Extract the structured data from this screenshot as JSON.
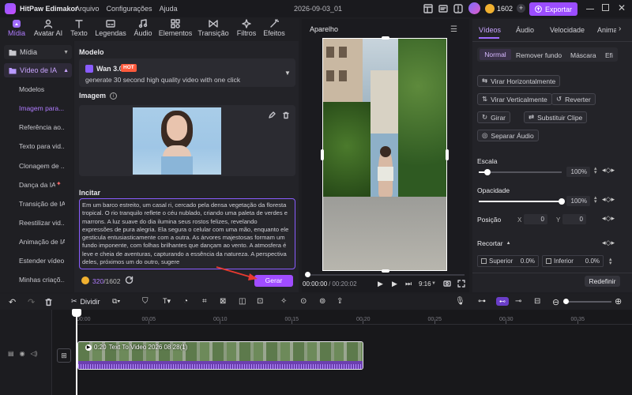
{
  "app": {
    "name": "HitPaw Edimakor",
    "menu": [
      "Arquivo",
      "Configurações",
      "Ajuda"
    ],
    "project": "2026-09-03_01",
    "credits": "1602",
    "export_label": "Exportar"
  },
  "toolbar": {
    "tabs": [
      "Mídia",
      "Avatar AI",
      "Texto",
      "Legendas",
      "Áudio",
      "Elementos",
      "Transição",
      "Filtros",
      "Efeitos"
    ]
  },
  "leftnav": {
    "sections": [
      "Mídia",
      "Vídeo de IA"
    ],
    "items": [
      "Modelos",
      "Imagem para...",
      "Referência ao...",
      "Texto para vid...",
      "Clonagem de ...",
      "Dança da IA",
      "Transição de IA",
      "Reestilizar vid...",
      "Animação de IA",
      "Estender vídeo",
      "Minhas criaçõ..."
    ]
  },
  "gen": {
    "model_label": "Modelo",
    "model_name": "Wan 3.0",
    "model_badge": "HOT",
    "model_desc": "generate 30 second high quality video with one click",
    "image_label": "Imagem",
    "prompt_label": "Incitar",
    "prompt_text": "Em um barco estreito, um casal ri, cercado pela densa vegetação da floresta tropical. O rio tranquilo reflete o céu nublado, criando uma paleta de verdes e marrons. A luz suave do dia ilumina seus rostos felizes, revelando expressões de pura alegria. Ela segura o celular com uma mão, enquanto ele gesticula entusiasticamente com a outra. As árvores majestosas formam um fundo imponente, com folhas brilhantes que dançam ao vento. A atmosfera é leve e cheia de aventuras, capturando a essência da natureza. A perspectiva deles, próximos um do outro, sugere",
    "char_count": "320",
    "char_max": "/1602",
    "generate_label": "Gerar"
  },
  "preview": {
    "title": "Aparelho",
    "time_current": "00:00:00",
    "time_total": "00:20:02",
    "ratio": "9:16",
    "progress": 0.0
  },
  "right": {
    "tabs": [
      "Vídeos",
      "Áudio",
      "Velocidade",
      "Animaç"
    ],
    "subtabs": [
      "Normal",
      "Remover fundo",
      "Máscara",
      "Efi"
    ],
    "buttons": [
      "Virar Horizontalmente",
      "Virar Verticalmente",
      "Reverter",
      "Girar",
      "Substituir Clipe",
      "Separar Áudio"
    ],
    "scale_label": "Escala",
    "scale_value": "100%",
    "scale_level": 0.1,
    "opacity_label": "Opacidade",
    "opacity_value": "100%",
    "opacity_level": 1.0,
    "position_label": "Posição",
    "pos_x_label": "X",
    "pos_x": "0",
    "pos_y_label": "Y",
    "pos_y": "0",
    "crop_label": "Recortar",
    "crop_top_label": "Superior",
    "crop_top": "0.0%",
    "crop_bottom_label": "Inferior",
    "crop_bottom": "0.0%",
    "reset_label": "Redefinir"
  },
  "timeline": {
    "split_label": "Dividir",
    "ticks": [
      "00:00",
      "00:05",
      "00:10",
      "00:15",
      "00:20",
      "00:25",
      "00:30",
      "00:35"
    ],
    "clip_duration": "0:20",
    "clip_name": "Text To Video 2026 08 28(1)"
  },
  "colors": {
    "accent": "#a04cff",
    "export": "#9b4dff",
    "generate": "#a04cff"
  }
}
